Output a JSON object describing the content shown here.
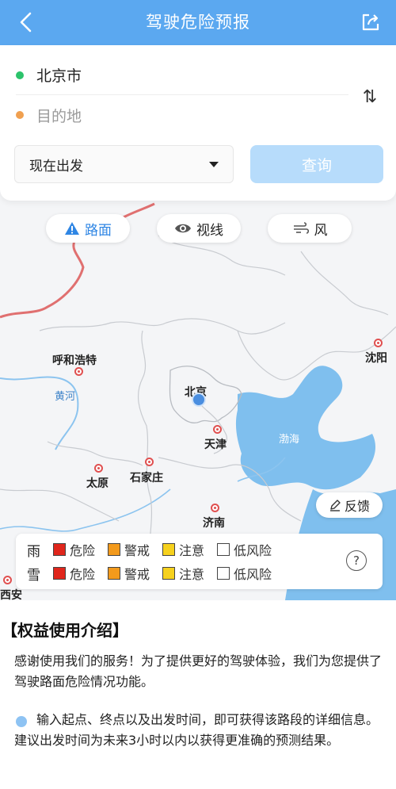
{
  "header": {
    "title": "驾驶危险预报"
  },
  "route": {
    "origin": "北京市",
    "destination_placeholder": "目的地",
    "swap_glyph": "⇅",
    "depart_time": "现在出发",
    "query_label": "查询"
  },
  "layers": [
    {
      "label": "路面",
      "icon": "warning-road-icon"
    },
    {
      "label": "视线",
      "icon": "eye-icon"
    },
    {
      "label": "风",
      "icon": "wind-icon"
    }
  ],
  "map": {
    "cities": [
      "呼和浩特",
      "北京",
      "天津",
      "石家庄",
      "太原",
      "济南",
      "沈阳",
      "西安"
    ],
    "water": [
      "黄河",
      "渤海"
    ]
  },
  "feedback_label": "反馈",
  "legend": {
    "rows": [
      {
        "label": "雨",
        "items": [
          "危险",
          "警戒",
          "注意",
          "低风险"
        ]
      },
      {
        "label": "雪",
        "items": [
          "危险",
          "警戒",
          "注意",
          "低风险"
        ]
      }
    ],
    "colors": [
      "#e0261c",
      "#f39a1c",
      "#f6d11d",
      "#ffffff"
    ],
    "help_glyph": "?"
  },
  "info": {
    "title": "【权益使用介绍】",
    "p1": "感谢使用我们的服务！为了提供更好的驾驶体验，我们为您提供了驾驶路面危险情况功能。",
    "p2": "输入起点、终点以及出发时间，即可获得该路段的详细信息。建议出发时间为未来3小时以内以获得更准确的预测结果。"
  },
  "colors": {
    "header": "#5ba8f0",
    "accent": "#2f86e4",
    "origin_dot": "#2cc36b",
    "destination_dot": "#f0a050",
    "query_button": "#b7dcfb"
  }
}
